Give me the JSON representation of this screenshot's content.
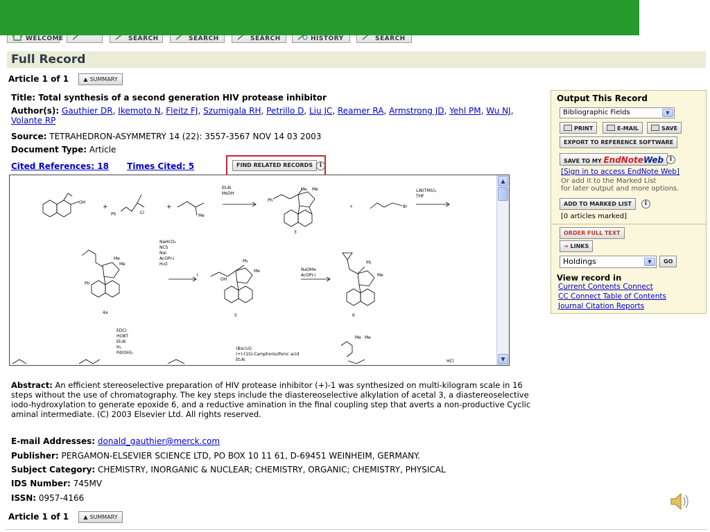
{
  "toolbar": {
    "buttons": [
      "WELCOME",
      "",
      "SEARCH",
      "SEARCH",
      "SEARCH",
      "HISTORY",
      "SEARCH"
    ]
  },
  "page_title": "Full Record",
  "article_nav": {
    "label": "Article 1 of 1",
    "summary_label": "SUMMARY"
  },
  "record": {
    "title_label": "Title:",
    "title": "Total synthesis of a second generation HIV protease inhibitor",
    "authors_label": "Author(s):",
    "authors": [
      "Gauthier DR",
      "Ikemoto N",
      "Fleitz FJ",
      "Szumigala RH",
      "Petrillo D",
      "Liu JC",
      "Reamer RA",
      "Armstrong JD",
      "Yehl PM",
      "Wu NJ",
      "Volante RP"
    ],
    "source_label": "Source:",
    "source": "TETRAHEDRON-ASYMMETRY 14 (22): 3557-3567 NOV 14 03 2003",
    "doctype_label": "Document Type:",
    "doctype": "Article",
    "cited_refs": "Cited References: 18",
    "times_cited": "Times Cited: 5",
    "find_related": "FIND RELATED RECORDS",
    "abstract_label": "Abstract:",
    "abstract": "An efficient stereoselective preparation of HIV protease inhibitor (+)-1 was synthesized on multi-kilogram scale in 16 steps without the use of chromatography. The key steps include the diastereoselective alkylation of acetal 3, a diastereoselective iodo-hydroxylation to generate epoxide 6, and a reductive amination in the final coupling step that averts a non-productive Cyclic aminal intermediate. (C) 2003 Elsevier Ltd. All rights reserved.",
    "email_label": "E-mail Addresses:",
    "email": "donald_gauthier@merck.com",
    "publisher_label": "Publisher:",
    "publisher": "PERGAMON-ELSEVIER SCIENCE LTD, PO BOX 10 11 61, D-69451 WEINHEIM, GERMANY.",
    "subject_label": "Subject Category:",
    "subject": "CHEMISTRY, INORGANIC & NUCLEAR; CHEMISTRY, ORGANIC; CHEMISTRY, PHYSICAL",
    "ids_label": "IDS Number:",
    "ids": "745MV",
    "issn_label": "ISSN:",
    "issn": "0957-4166"
  },
  "scheme": {
    "reagents_1": [
      "Et3N",
      "MsOH"
    ],
    "reagents_2": [
      "LiN(TMS)2",
      "THF"
    ],
    "reagents_3": [
      "NaHCO3",
      "NCS",
      "NaI",
      "AcOPr-i",
      "H2O"
    ],
    "reagents_4": [
      "NaOMe",
      "AcOPr-i"
    ],
    "reagents_5": [
      "EDCI",
      "HOBT",
      "Et3N",
      "H2",
      "Pd(OH)2"
    ],
    "reagents_6": [
      "(Boc)2O",
      "(+)-(1S)-Camphorsulfonic acid",
      "Et3N"
    ],
    "labels": [
      "3",
      "4a",
      "5",
      "6",
      "Me",
      "Ph",
      "Cl",
      "Br",
      "OH",
      "HCl"
    ]
  },
  "panel": {
    "title": "Output This Record",
    "fields_select": "Bibliographic Fields",
    "print": "PRINT",
    "email": "E-MAIL",
    "save": "SAVE",
    "export": "EXPORT TO REFERENCE SOFTWARE",
    "save_to": "SAVE TO MY",
    "endnote": "EndNote",
    "web": "Web",
    "sign_in": "[Sign in to access EndNote Web]",
    "or_add": "Or add it to the Marked List",
    "for_later": "for later output and more options.",
    "add_marked": "ADD TO MARKED LIST",
    "marked_count": "[0 articles marked]",
    "order": "ORDER FULL TEXT",
    "links": "LINKS",
    "holdings": "Holdings",
    "go": "GO",
    "view_in": "View record in",
    "view_links": [
      "Current Contents Connect",
      "CC Connect Table of Contents",
      "Journal Citation Reports"
    ]
  },
  "colors": {
    "banner": "#279a2e",
    "header_bg": "#eaecd8",
    "panel_bg": "#fbf7dd",
    "highlight": "#c8282d",
    "link": "#0000cc"
  }
}
